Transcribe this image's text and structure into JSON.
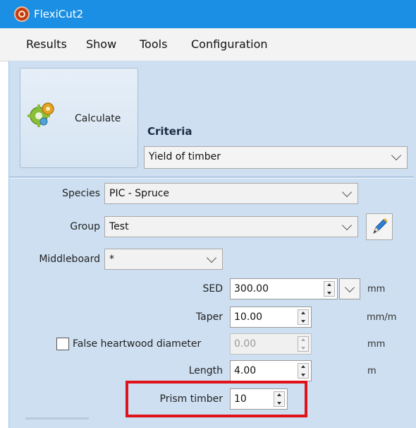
{
  "window": {
    "title": "FlexiCut2"
  },
  "menu": [
    "Results",
    "Show",
    "Tools",
    "Configuration"
  ],
  "toolbar": {
    "calculate_label": "Calculate"
  },
  "criteria": {
    "label": "Criteria",
    "value": "Yield of timber"
  },
  "fields": {
    "species": {
      "label": "Species",
      "value": "PIC - Spruce"
    },
    "group": {
      "label": "Group",
      "value": "Test"
    },
    "middleboard": {
      "label": "Middleboard",
      "value": "*"
    },
    "sed": {
      "label": "SED",
      "value": "300.00",
      "unit": "mm"
    },
    "taper": {
      "label": "Taper",
      "value": "10.00",
      "unit": "mm/m"
    },
    "false_heartwood": {
      "label": "False heartwood diameter",
      "value": "0.00",
      "unit": "mm",
      "checked": false
    },
    "length": {
      "label": "Length",
      "value": "4.00",
      "unit": "m"
    },
    "prism_timber": {
      "label": "Prism timber",
      "value": "10"
    }
  },
  "icons": [
    "app-icon",
    "gears-icon",
    "pencil-icon",
    "chevron-down-icon",
    "spin-arrows-icon"
  ],
  "colors": {
    "titlebar": "#1a8fe3",
    "panel": "#cddff1",
    "highlight": "#e0121a"
  }
}
